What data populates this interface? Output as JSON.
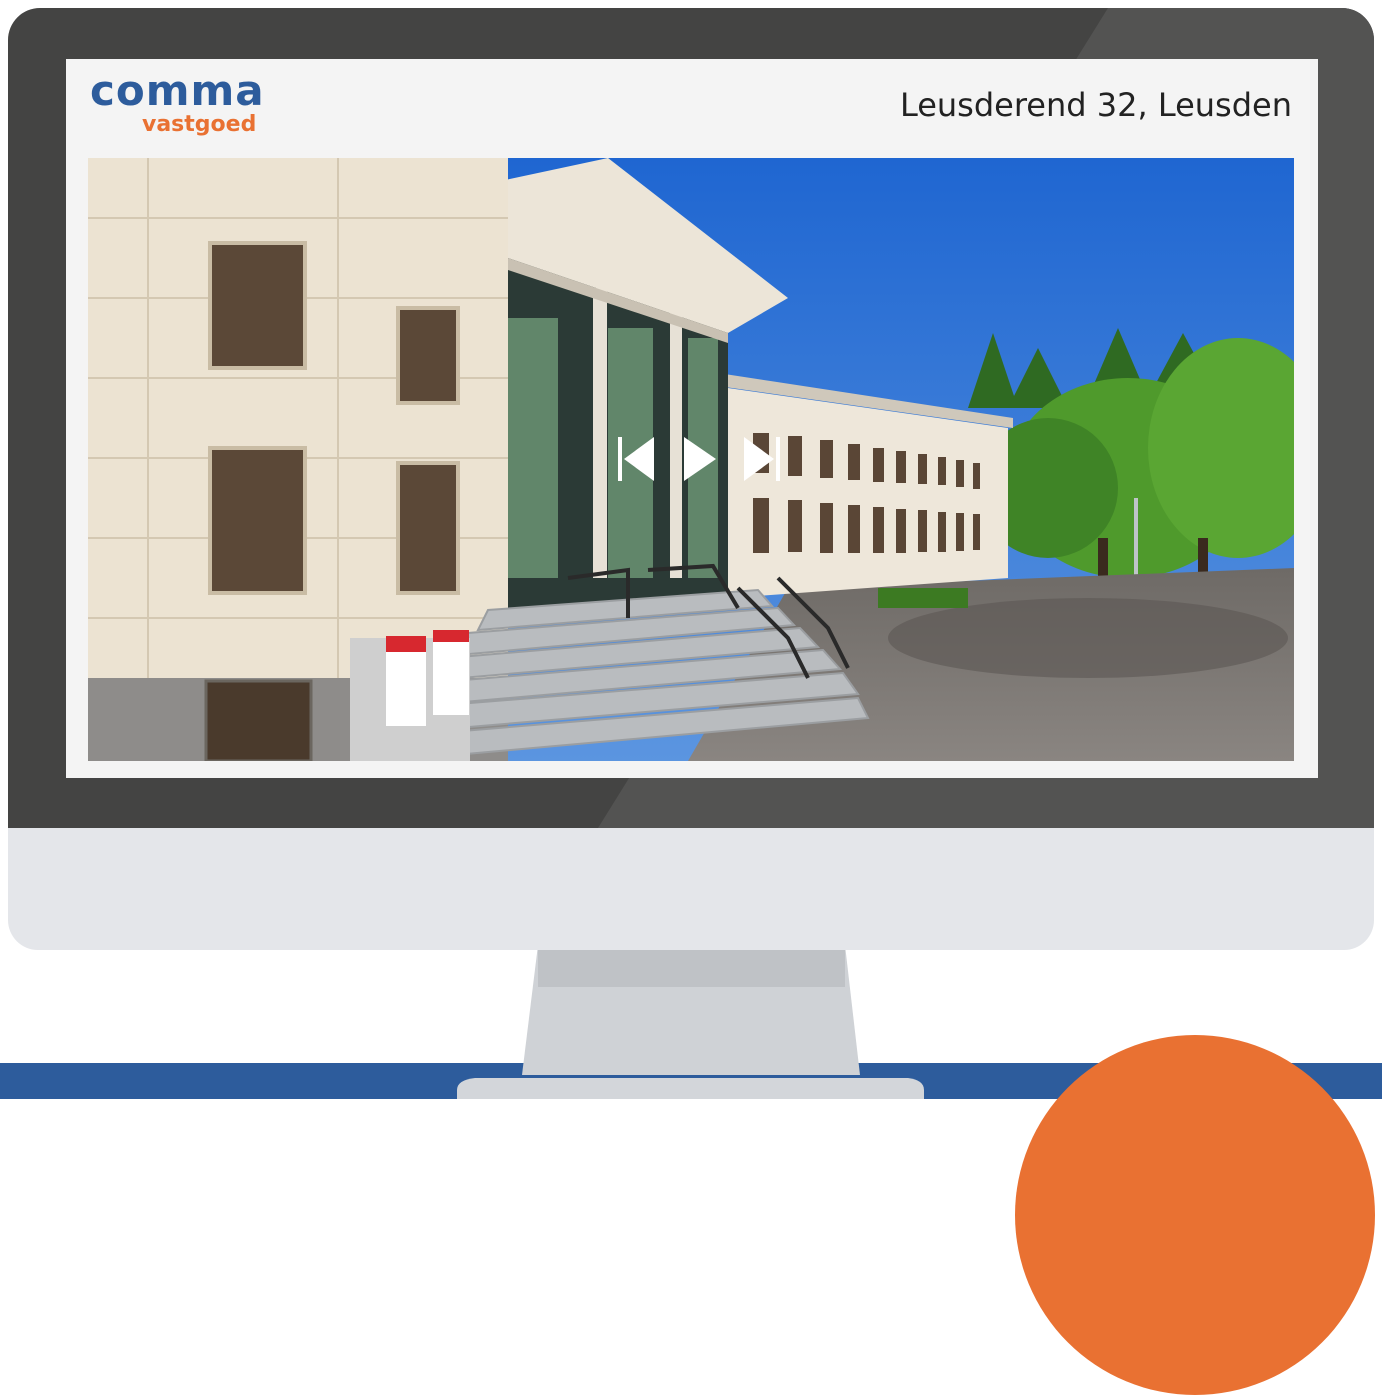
{
  "brand": {
    "name": "comma",
    "tagline": "vastgoed",
    "primary_color": "#2d5c9c",
    "accent_color": "#e97132"
  },
  "listing": {
    "address": "Leusderend 32, Leusden"
  },
  "slideshow": {
    "controls": [
      {
        "name": "previous-button",
        "icon": "skip-previous-icon"
      },
      {
        "name": "play-button",
        "icon": "play-icon"
      },
      {
        "name": "next-button",
        "icon": "skip-next-icon"
      }
    ]
  }
}
